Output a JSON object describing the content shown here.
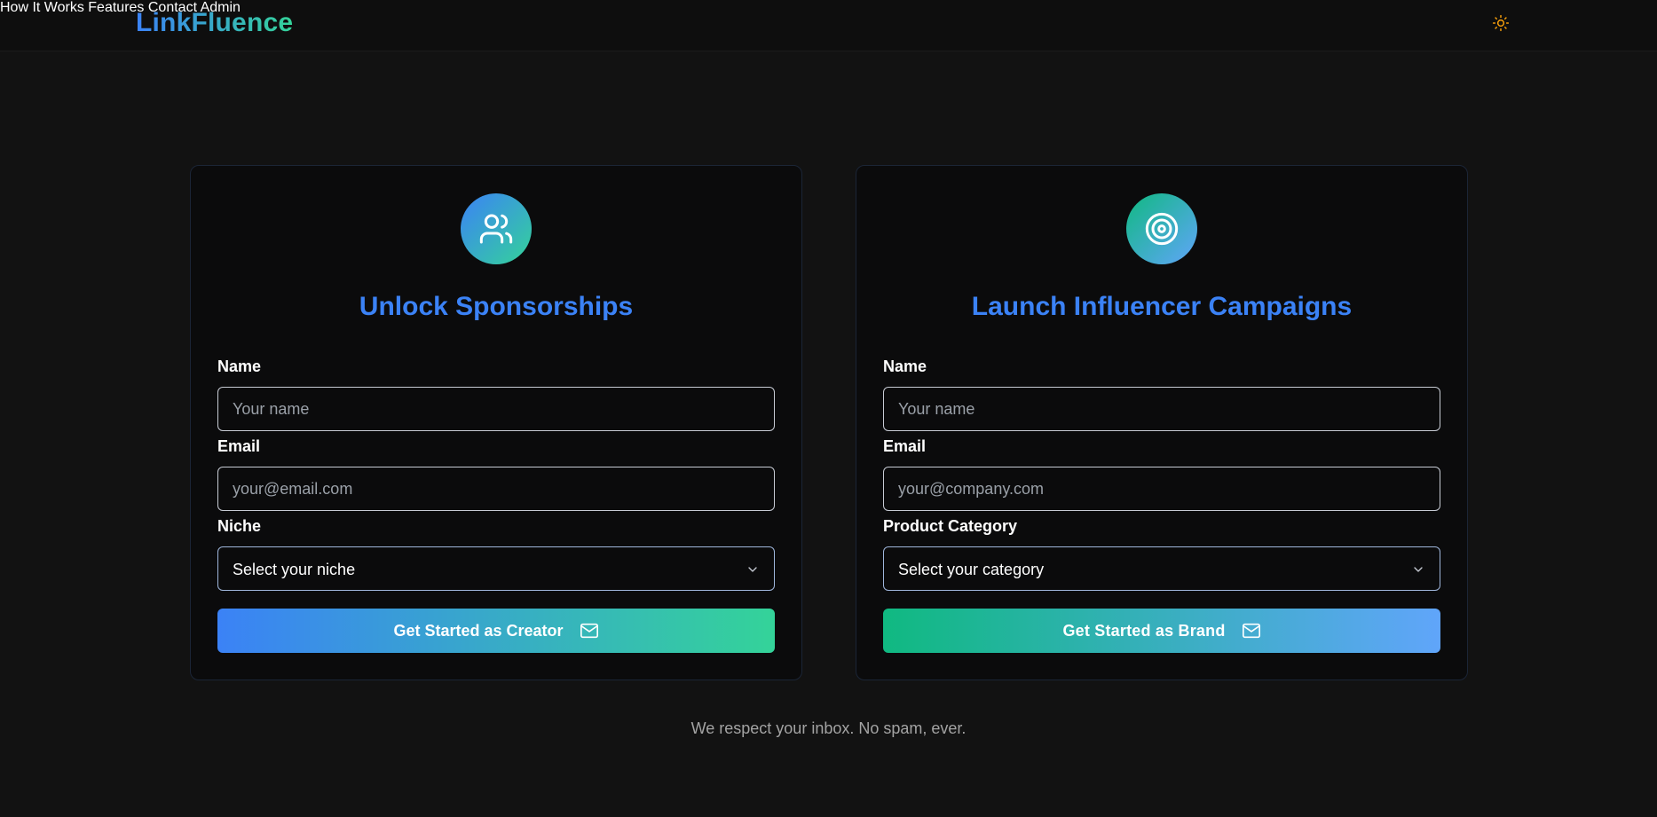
{
  "header": {
    "brand": "LinkFluence",
    "nav": [
      "How It Works",
      "Features",
      "Contact",
      "Admin"
    ]
  },
  "creator_card": {
    "icon": "users-icon",
    "title": "Unlock Sponsorships",
    "name_label": "Name",
    "name_placeholder": "Your name",
    "email_label": "Email",
    "email_placeholder": "your@email.com",
    "select_label": "Niche",
    "select_value": "Select your niche",
    "button_label": "Get Started as Creator"
  },
  "brand_card": {
    "icon": "target-icon",
    "title": "Launch Influencer Campaigns",
    "name_label": "Name",
    "name_placeholder": "Your name",
    "email_label": "Email",
    "email_placeholder": "your@company.com",
    "select_label": "Product Category",
    "select_value": "Select your category",
    "button_label": "Get Started as Brand"
  },
  "footnote": "We respect your inbox. No spam, ever.",
  "colors": {
    "accent_blue": "#3b82f6",
    "accent_green": "#34d399",
    "brand_green": "#10b981",
    "brand_blue": "#60a5fa",
    "background": "#121212",
    "theme_icon": "#f59e0b"
  }
}
